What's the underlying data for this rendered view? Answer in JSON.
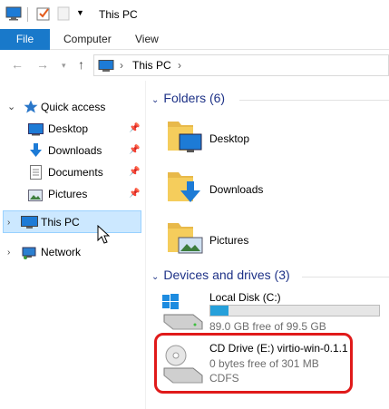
{
  "window": {
    "title": "This PC"
  },
  "ribbon": {
    "file": "File",
    "tabs": [
      "Computer",
      "View"
    ]
  },
  "address": {
    "path": "This PC"
  },
  "nav": {
    "quick_access": "Quick access",
    "quick_items": [
      "Desktop",
      "Downloads",
      "Documents",
      "Pictures"
    ],
    "this_pc": "This PC",
    "network": "Network"
  },
  "content": {
    "folders_header": "Folders (6)",
    "folders": [
      "Desktop",
      "Downloads",
      "Pictures"
    ],
    "devices_header": "Devices and drives (3)",
    "local_disk": {
      "name": "Local Disk (C:)",
      "free": "89.0 GB free of 99.5 GB",
      "used_fraction": 0.106
    },
    "cd_drive": {
      "name": "CD Drive (E:) virtio-win-0.1.1",
      "free": "0 bytes free of 301 MB",
      "fs": "CDFS"
    }
  },
  "colors": {
    "accent": "#1979ca",
    "selection": "#cce8ff",
    "header": "#1e3287",
    "highlight_box": "#e01a1a"
  }
}
